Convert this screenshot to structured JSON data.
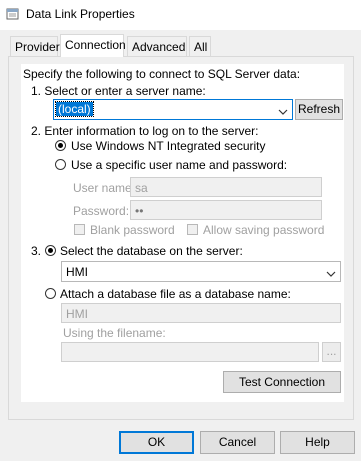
{
  "window": {
    "title": "Data Link Properties"
  },
  "tabs": [
    {
      "label": "Provider"
    },
    {
      "label": "Connection"
    },
    {
      "label": "Advanced"
    },
    {
      "label": "All"
    }
  ],
  "connection": {
    "intro": "Specify the following to connect to SQL Server data:",
    "step1": "1. Select or enter a server name:",
    "server_value": "(local)",
    "refresh_label": "Refresh",
    "step2": "2. Enter information to log on to the server:",
    "option_nt": "Use Windows NT Integrated security",
    "option_specific": "Use a specific user name and password:",
    "username_label": "User name:",
    "username_value": "sa",
    "password_label": "Password:",
    "password_value": "••",
    "blank_password_label": "Blank password",
    "allow_saving_label": "Allow saving password",
    "step3_number": "3.",
    "option_select_db": "Select the database on the server:",
    "database_value": "HMI",
    "option_attach": "Attach a database file as a database name:",
    "attach_name_value": "HMI",
    "filename_label": "Using the filename:",
    "browse_label": "...",
    "test_connection_label": "Test Connection"
  },
  "footer": {
    "ok_label": "OK",
    "cancel_label": "Cancel",
    "help_label": "Help"
  },
  "colors": {
    "accent": "#0078d7",
    "selection": "#0078d7"
  }
}
